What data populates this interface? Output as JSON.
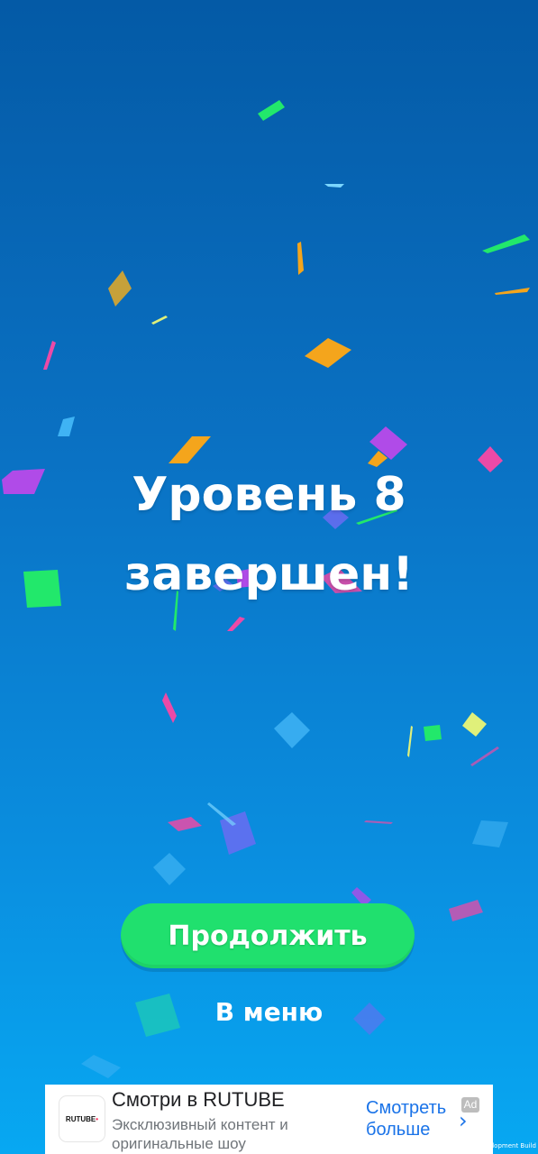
{
  "screen": {
    "title_line1": "Уровень 8",
    "title_line2": "завершен!",
    "continue_label": "Продолжить",
    "menu_label": "В меню"
  },
  "ad": {
    "logo_text": "RUTUBE",
    "title": "Смотри в RUTUBE",
    "description": "Эксклюзивный контент и оригинальные шоу",
    "cta": "Смотреть больше",
    "badge": "Ad",
    "chevron_icon": "chevron-right-icon"
  },
  "footer": {
    "build_label": "Development Build"
  },
  "colors": {
    "continue_button": "#20e06e",
    "confetti": [
      "#22e86b",
      "#f4a51c",
      "#c6a13a",
      "#b04be8",
      "#ec4aa7",
      "#3fb3f4",
      "#e0f07a",
      "#6a6cf2"
    ]
  }
}
